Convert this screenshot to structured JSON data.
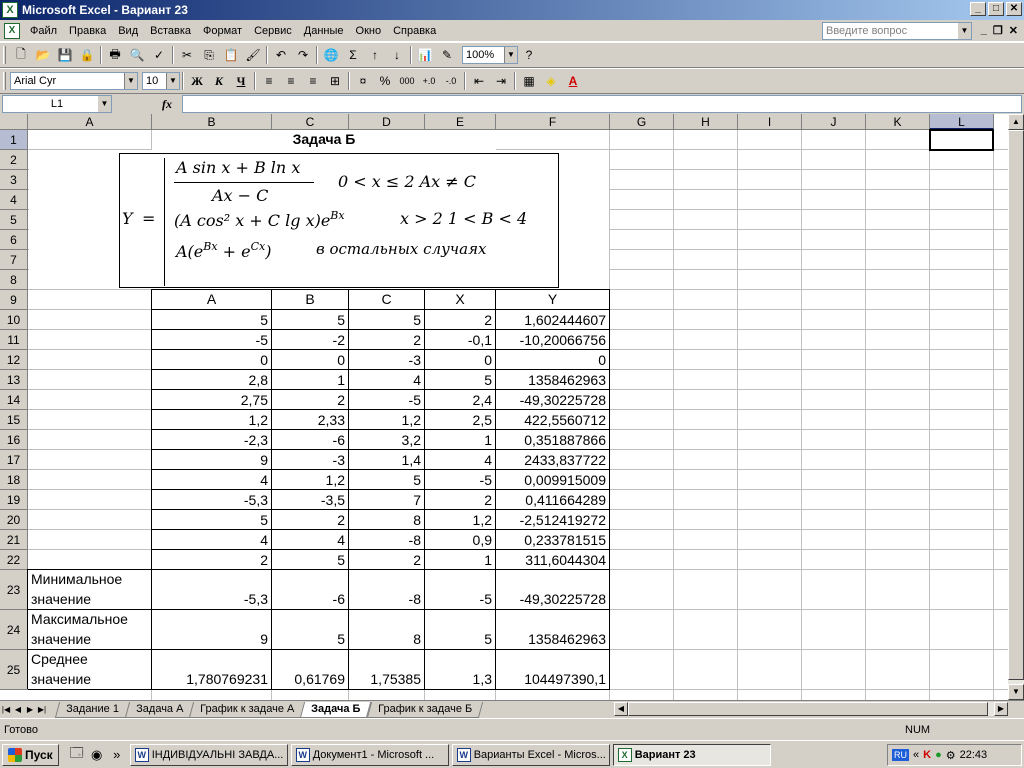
{
  "window": {
    "title": "Microsoft Excel - Вариант 23",
    "min": "_",
    "max": "□",
    "close": "✕"
  },
  "menu": {
    "items": [
      "Файл",
      "Правка",
      "Вид",
      "Вставка",
      "Формат",
      "Сервис",
      "Данные",
      "Окно",
      "Справка"
    ],
    "help_placeholder": "Введите вопрос",
    "doc_min": "_",
    "doc_restore": "❐",
    "doc_close": "✕"
  },
  "toolbar": {
    "zoom": "100%",
    "font": "Arial Cyr",
    "size": "10",
    "bold": "Ж",
    "italic": "К",
    "underline": "Ч",
    "sigma": "Σ",
    "percent": "%",
    "thousands": "000"
  },
  "formula_bar": {
    "name_box": "L1",
    "fx": "fx",
    "value": ""
  },
  "columns": [
    "A",
    "B",
    "C",
    "D",
    "E",
    "F",
    "G",
    "H",
    "I",
    "J",
    "K",
    "L"
  ],
  "rows": [
    "1",
    "2",
    "3",
    "4",
    "5",
    "6",
    "7",
    "8",
    "9",
    "10",
    "11",
    "12",
    "13",
    "14",
    "15",
    "16",
    "17",
    "18",
    "19",
    "20",
    "21",
    "22",
    "23",
    "24",
    "25"
  ],
  "title": "Задача Б",
  "formula": {
    "y_label": "Y",
    "eq": "=",
    "case1_num": "A sin x + B ln x",
    "case1_den": "Ax − C",
    "case1_cond": "0 < x ≤ 2   Ax ≠ C",
    "case2_expr": "(A cos² x + C lg x)e",
    "case2_sup": "Bx",
    "case2_cond": "x > 2    1 < B < 4",
    "case3_expr_a": "A(e",
    "case3_sup1": "Bx",
    "case3_expr_b": " + e",
    "case3_sup2": "Cx",
    "case3_expr_c": ")",
    "case3_cond": "в остальных   случаях"
  },
  "table": {
    "headers": [
      "A",
      "B",
      "C",
      "X",
      "Y"
    ],
    "rows": [
      [
        "5",
        "5",
        "5",
        "2",
        "1,602444607"
      ],
      [
        "-5",
        "-2",
        "2",
        "-0,1",
        "-10,20066756"
      ],
      [
        "0",
        "0",
        "-3",
        "0",
        "0"
      ],
      [
        "2,8",
        "1",
        "4",
        "5",
        "1358462963"
      ],
      [
        "2,75",
        "2",
        "-5",
        "2,4",
        "-49,30225728"
      ],
      [
        "1,2",
        "2,33",
        "1,2",
        "2,5",
        "422,5560712"
      ],
      [
        "-2,3",
        "-6",
        "3,2",
        "1",
        "0,351887866"
      ],
      [
        "9",
        "-3",
        "1,4",
        "4",
        "2433,837722"
      ],
      [
        "4",
        "1,2",
        "5",
        "-5",
        "0,009915009"
      ],
      [
        "-5,3",
        "-3,5",
        "7",
        "2",
        "0,411664289"
      ],
      [
        "5",
        "2",
        "8",
        "1,2",
        "-2,512419272"
      ],
      [
        "4",
        "4",
        "-8",
        "0,9",
        "0,233781515"
      ],
      [
        "2",
        "5",
        "2",
        "1",
        "311,6044304"
      ]
    ],
    "stats": [
      {
        "label1": "Минимальное",
        "label2": "значение",
        "values": [
          "-5,3",
          "-6",
          "-8",
          "-5",
          "-49,30225728"
        ]
      },
      {
        "label1": "Максимальное",
        "label2": "значение",
        "values": [
          "9",
          "5",
          "8",
          "5",
          "1358462963"
        ]
      },
      {
        "label1": "Среднее",
        "label2": "значение",
        "values": [
          "1,780769231",
          "0,61769",
          "1,75385",
          "1,3",
          "104497390,1"
        ]
      }
    ]
  },
  "sheet_tabs": [
    {
      "label": "Задание 1",
      "active": false
    },
    {
      "label": "Задача А",
      "active": false
    },
    {
      "label": "График к задаче А",
      "active": false
    },
    {
      "label": "Задача Б",
      "active": true
    },
    {
      "label": "График к задаче Б",
      "active": false
    }
  ],
  "status": {
    "text": "Готово",
    "num": "NUM"
  },
  "taskbar": {
    "start": "Пуск",
    "chevron": "»",
    "buttons": [
      {
        "label": "ІНДИВІДУАЛЬНІ ЗАВДА...",
        "icon": "W",
        "active": false
      },
      {
        "label": "Документ1 - Microsoft ...",
        "icon": "W",
        "active": false
      },
      {
        "label": "Варианты Excel - Micros...",
        "icon": "W",
        "active": false
      },
      {
        "label": "Вариант 23",
        "icon": "X",
        "active": true
      }
    ],
    "lang": "RU",
    "tray_chevron": "«",
    "clock": "22:43"
  }
}
